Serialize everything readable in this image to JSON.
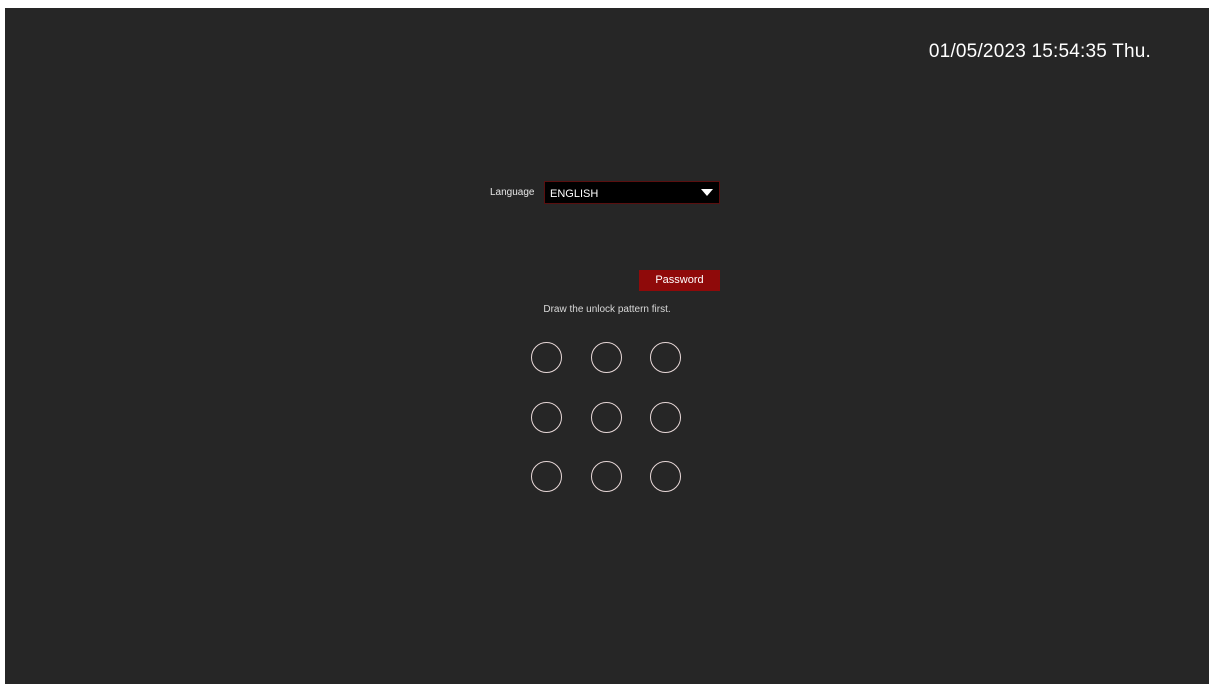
{
  "clock": {
    "datetime": "01/05/2023 15:54:35 Thu."
  },
  "language": {
    "label": "Language",
    "selected": "ENGLISH"
  },
  "password_button": {
    "label": "Password"
  },
  "pattern": {
    "hint": "Draw the unlock pattern first.",
    "rows": 3,
    "cols": 3
  },
  "colors": {
    "background": "#262626",
    "accent": "#8f0a0a",
    "pattern_ring": "#e8d8d8"
  }
}
